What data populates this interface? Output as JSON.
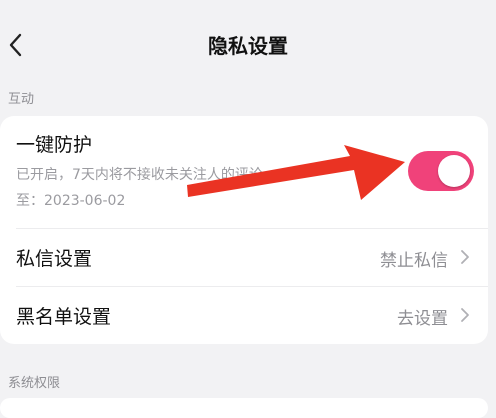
{
  "header": {
    "title": "隐私设置"
  },
  "sections": {
    "interaction": "互动",
    "system": "系统权限"
  },
  "protection": {
    "title": "一键防护",
    "desc_line1": "已开启，7天内将不接收未关注人的评论",
    "desc_line2": "至：2023-06-02",
    "enabled": true
  },
  "rows": [
    {
      "label": "私信设置",
      "value": "禁止私信"
    },
    {
      "label": "黑名单设置",
      "value": "去设置"
    }
  ],
  "colors": {
    "toggle_on": "#f0427a",
    "arrow": "#ea3323",
    "background": "#f2f2f4"
  }
}
